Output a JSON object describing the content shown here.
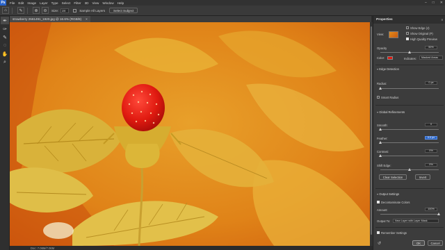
{
  "menubar": {
    "logo": "Ps",
    "items": [
      "File",
      "Edit",
      "Image",
      "Layer",
      "Type",
      "Select",
      "Filter",
      "3D",
      "View",
      "Window",
      "Help"
    ],
    "window_controls": [
      "–",
      "□",
      "✕"
    ]
  },
  "options_bar": {
    "size_label": "Size:",
    "size_value": "24",
    "sample_all_layers_label": "Sample All Layers",
    "select_subject_label": "Select Subject"
  },
  "document": {
    "tab_title": "strawberry 2561491_1920.jpg @ 16.6% (RGB/8)",
    "close_glyph": "×",
    "status_text": "Doc: 7.06M/7.06M"
  },
  "properties": {
    "title": "Properties",
    "view_label": "View:",
    "show_edge_label": "Show Edge (J)",
    "show_original_label": "Show Original (P)",
    "high_quality_preview_label": "High Quality Preview",
    "opacity_label": "Opacity",
    "opacity_value": "50%",
    "opacity_level": 0.5,
    "color_label": "Color:",
    "indicates_label": "Indicates:",
    "indicates_value": "Masked Areas",
    "mask_color": "#e01a10",
    "edge_detection_label": "Edge Detection",
    "radius_label": "Radius:",
    "radius_value": "0 px",
    "radius_level": 0.0,
    "smart_radius_label": "Smart Radius",
    "global_refinements_label": "Global Refinements",
    "smooth_label": "Smooth:",
    "smooth_value": "0",
    "smooth_level": 0.0,
    "feather_label": "Feather:",
    "feather_value": "0.0 px",
    "feather_level": 0.0,
    "contrast_label": "Contrast:",
    "contrast_value": "0%",
    "contrast_level": 0.0,
    "shift_edge_label": "Shift Edge:",
    "shift_edge_value": "0%",
    "shift_edge_level": 0.5,
    "clear_selection_label": "Clear Selection",
    "invert_label": "Invert",
    "output_settings_label": "Output Settings",
    "decontaminate_label": "Decontaminate Colors",
    "amount_label": "Amount:",
    "amount_value": "100%",
    "amount_level": 1.0,
    "output_to_label": "Output To:",
    "output_to_value": "New Layer with Layer Mask",
    "remember_settings_label": "Remember Settings",
    "ok_label": "OK",
    "cancel_label": "Cancel"
  },
  "tools": [
    "quick-selection-icon",
    "refine-edge-brush-icon",
    "brush-icon",
    "lasso-icon",
    "hand-icon",
    "zoom-icon"
  ]
}
